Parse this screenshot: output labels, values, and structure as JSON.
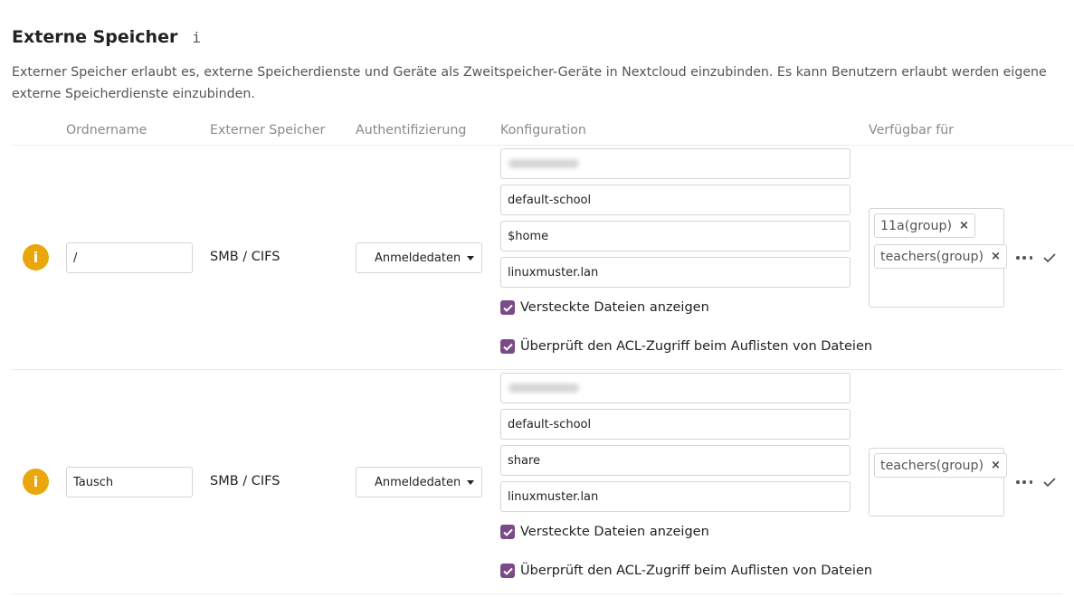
{
  "section": {
    "title": "Externe Speicher",
    "info_glyph": "i",
    "description": "Externer Speicher erlaubt es, externe Speicherdienste und Geräte als Zweitspeicher-Geräte in Nextcloud einzubinden. Es kann Benutzern erlaubt werden eigene externe Speicherdienste einzubinden."
  },
  "columns": {
    "folder_name": "Ordnername",
    "external_storage": "Externer Speicher",
    "authentication": "Authentifizierung",
    "configuration": "Konfiguration",
    "available_for": "Verfügbar für"
  },
  "mounts": [
    {
      "status_glyph": "i",
      "folder_name": "/",
      "backend": "SMB / CIFS",
      "auth": "Anmeldedaten i",
      "config": {
        "host": "",
        "share": "default-school",
        "remote_subfolder": "$home",
        "domain": "linuxmuster.lan"
      },
      "checkboxes": {
        "show_hidden": "Versteckte Dateien anzeigen",
        "check_acl": "Überprüft den ACL-Zugriff beim Auflisten von Dateien"
      },
      "groups": [
        "11a(group)",
        "teachers(group)"
      ],
      "remove_glyph": "×"
    },
    {
      "status_glyph": "i",
      "folder_name": "Tausch",
      "backend": "SMB / CIFS",
      "auth": "Anmeldedaten i",
      "config": {
        "host": "",
        "share": "default-school",
        "remote_subfolder": "share",
        "domain": "linuxmuster.lan"
      },
      "checkboxes": {
        "show_hidden": "Versteckte Dateien anzeigen",
        "check_acl": "Überprüft den ACL-Zugriff beim Auflisten von Dateien"
      },
      "groups": [
        "teachers(group)"
      ],
      "remove_glyph": "×"
    }
  ],
  "colors": {
    "status_warning": "#e9a70b",
    "checkbox_accent": "#7b4b87",
    "muted_text": "#8a8a8a"
  },
  "icons": {
    "status": "info-warning-icon",
    "more": "more-horizontal-icon",
    "save": "checkmark-icon",
    "remove": "close-icon",
    "dropdown": "caret-down-icon"
  }
}
